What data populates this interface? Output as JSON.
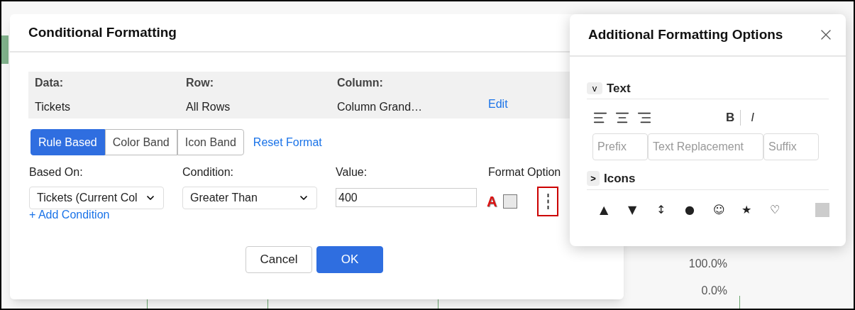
{
  "background": {
    "axis_labels": [
      "100.0%",
      "0.0%"
    ]
  },
  "dialog": {
    "title": "Conditional Formatting",
    "info": [
      {
        "label": "Data:",
        "value": "Tickets"
      },
      {
        "label": "Row:",
        "value": "All Rows"
      },
      {
        "label": "Column:",
        "value": "Column Grand…"
      }
    ],
    "edit_link": "Edit",
    "tabs": [
      {
        "label": "Rule Based",
        "selected": true
      },
      {
        "label": "Color Band",
        "selected": false
      },
      {
        "label": "Icon Band",
        "selected": false
      }
    ],
    "reset_link": "Reset Format",
    "based_on": {
      "label": "Based On:",
      "value": "Tickets (Current Col"
    },
    "condition": {
      "label": "Condition:",
      "value": "Greater Than"
    },
    "value": {
      "label": "Value:",
      "value": "400"
    },
    "format_options": {
      "label": "Format Option",
      "font_color_glyph": "A"
    },
    "add_condition": "+ Add Condition",
    "buttons": [
      {
        "label": "Cancel",
        "kind": "secondary"
      },
      {
        "label": "OK",
        "kind": "primary"
      }
    ]
  },
  "panel": {
    "title": "Additional Formatting Options",
    "text_section": {
      "toggle": "v",
      "title": "Text",
      "bold": "B",
      "italic": "I",
      "fields": [
        {
          "placeholder": "Prefix"
        },
        {
          "placeholder": "Text Replacement"
        },
        {
          "placeholder": "Suffix"
        }
      ]
    },
    "icons_section": {
      "toggle": ">",
      "title": "Icons",
      "symbols": [
        "▲",
        "▼",
        "↕",
        "●",
        "☺",
        "★",
        "♡"
      ]
    }
  }
}
